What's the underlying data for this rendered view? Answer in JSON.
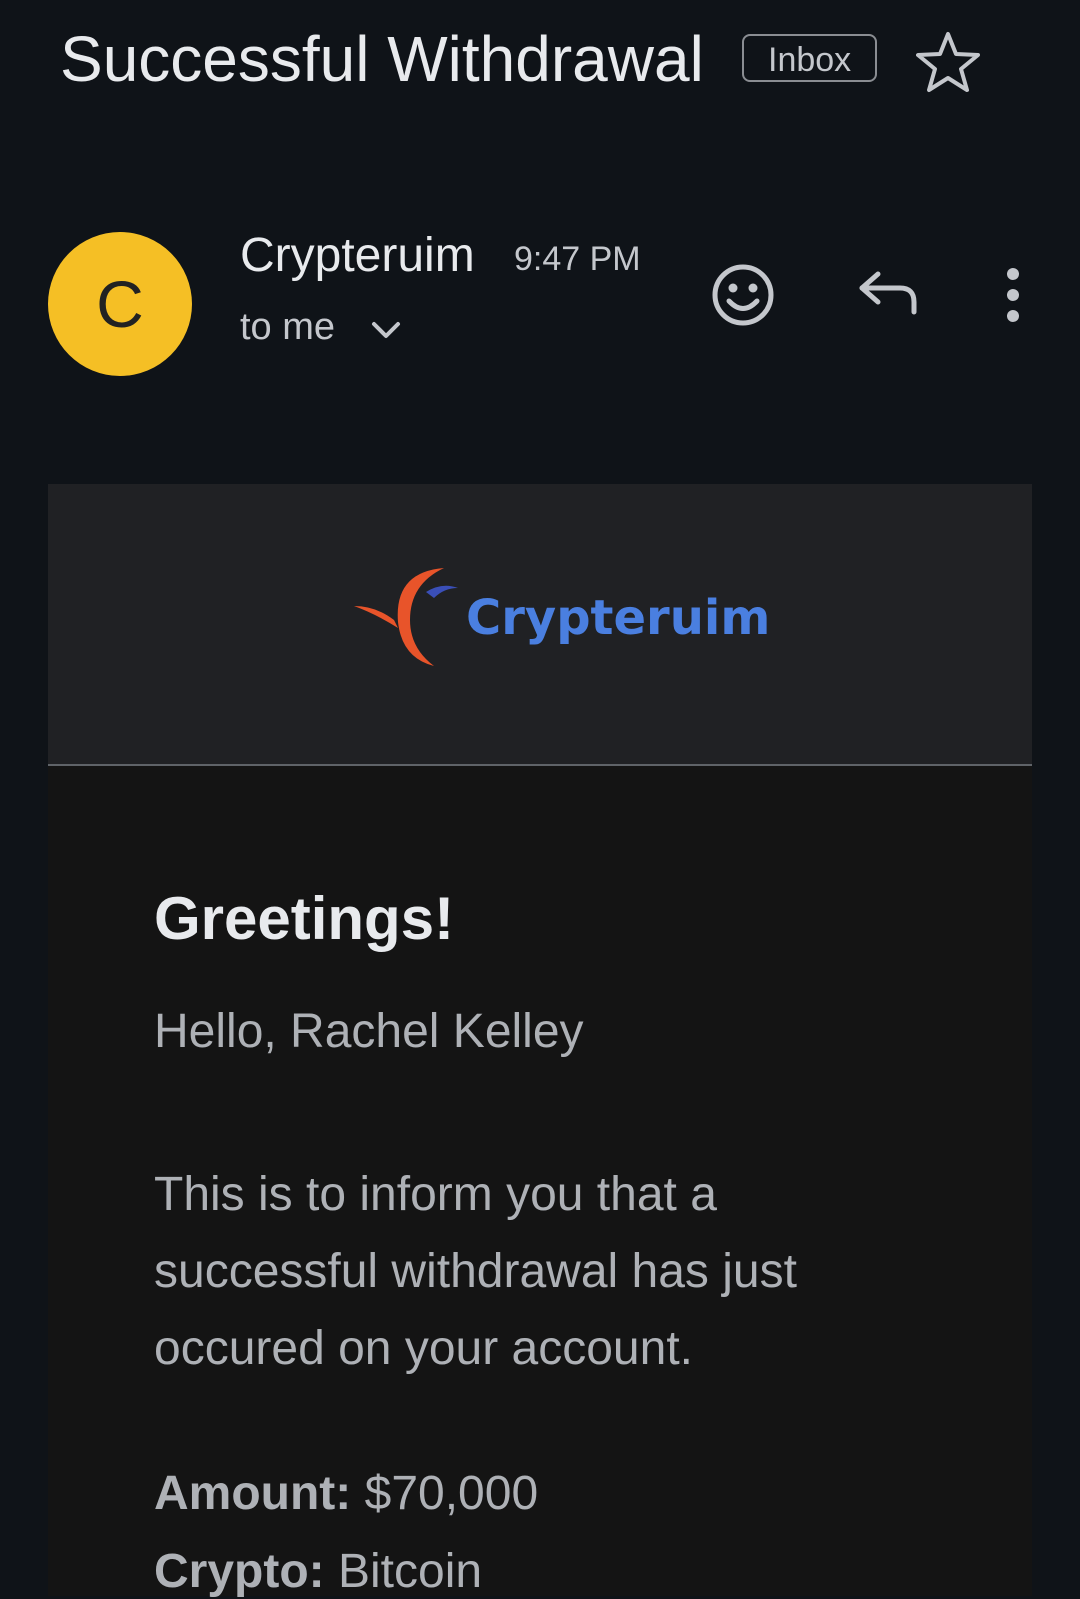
{
  "email": {
    "subject": "Successful Withdrawal",
    "label_badge": "Inbox",
    "sender": {
      "avatar_letter": "C",
      "avatar_color": "#f5bf25",
      "name": "Crypteruim",
      "time": "9:47 PM",
      "recipient": "to me"
    },
    "actions": {
      "star_icon": "star-outline-icon",
      "reaction_icon": "smiley-icon",
      "reply_icon": "reply-icon",
      "more_icon": "more-vertical-icon"
    }
  },
  "body": {
    "logo_text": "Crypteruim",
    "logo_colors": {
      "swoosh": "#e8542a",
      "text": "#4a7fe0"
    },
    "greeting": "Greetings!",
    "salutation": "Hello, Rachel Kelley",
    "message": "This is to inform you that a successful withdrawal has just occured on your account.",
    "details": [
      {
        "label": "Amount:",
        "value": "$70,000"
      },
      {
        "label": "Crypto:",
        "value": "Bitcoin"
      }
    ]
  }
}
